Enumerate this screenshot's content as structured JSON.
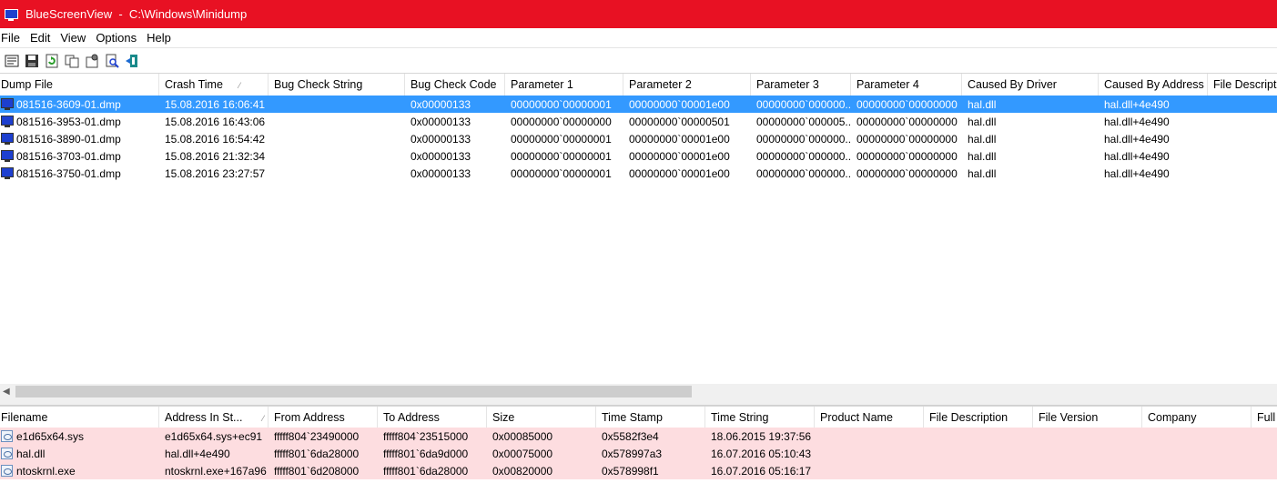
{
  "window": {
    "title": "BlueScreenView  -  C:\\Windows\\Minidump"
  },
  "menu": [
    "File",
    "Edit",
    "View",
    "Options",
    "Help"
  ],
  "toolbar": {
    "icons": [
      "properties-icon",
      "save-icon",
      "refresh-icon",
      "copy-icon",
      "settings-icon",
      "find-icon",
      "exit-icon"
    ]
  },
  "dumps": {
    "columns": [
      "Dump File",
      "Crash Time",
      "Bug Check String",
      "Bug Check Code",
      "Parameter 1",
      "Parameter 2",
      "Parameter 3",
      "Parameter 4",
      "Caused By Driver",
      "Caused By Address",
      "File Description"
    ],
    "sort_indicator": "⁄",
    "rows": [
      [
        "081516-3609-01.dmp",
        "15.08.2016 16:06:41",
        "",
        "0x00000133",
        "00000000`00000001",
        "00000000`00001e00",
        "00000000`000000...",
        "00000000`00000000",
        "hal.dll",
        "hal.dll+4e490",
        ""
      ],
      [
        "081516-3953-01.dmp",
        "15.08.2016 16:43:06",
        "",
        "0x00000133",
        "00000000`00000000",
        "00000000`00000501",
        "00000000`000005...",
        "00000000`00000000",
        "hal.dll",
        "hal.dll+4e490",
        ""
      ],
      [
        "081516-3890-01.dmp",
        "15.08.2016 16:54:42",
        "",
        "0x00000133",
        "00000000`00000001",
        "00000000`00001e00",
        "00000000`000000...",
        "00000000`00000000",
        "hal.dll",
        "hal.dll+4e490",
        ""
      ],
      [
        "081516-3703-01.dmp",
        "15.08.2016 21:32:34",
        "",
        "0x00000133",
        "00000000`00000001",
        "00000000`00001e00",
        "00000000`000000...",
        "00000000`00000000",
        "hal.dll",
        "hal.dll+4e490",
        ""
      ],
      [
        "081516-3750-01.dmp",
        "15.08.2016 23:27:57",
        "",
        "0x00000133",
        "00000000`00000001",
        "00000000`00001e00",
        "00000000`000000...",
        "00000000`00000000",
        "hal.dll",
        "hal.dll+4e490",
        ""
      ]
    ]
  },
  "drivers": {
    "columns": [
      "Filename",
      "Address In St...",
      "From Address",
      "To Address",
      "Size",
      "Time Stamp",
      "Time String",
      "Product Name",
      "File Description",
      "File Version",
      "Company",
      "Full"
    ],
    "sort_indicator": "⁄",
    "rows": [
      [
        "e1d65x64.sys",
        "e1d65x64.sys+ec91",
        "fffff804`23490000",
        "fffff804`23515000",
        "0x00085000",
        "0x5582f3e4",
        "18.06.2015 19:37:56",
        "",
        "",
        "",
        "",
        ""
      ],
      [
        "hal.dll",
        "hal.dll+4e490",
        "fffff801`6da28000",
        "fffff801`6da9d000",
        "0x00075000",
        "0x578997a3",
        "16.07.2016 05:10:43",
        "",
        "",
        "",
        "",
        ""
      ],
      [
        "ntoskrnl.exe",
        "ntoskrnl.exe+167a96",
        "fffff801`6d208000",
        "fffff801`6da28000",
        "0x00820000",
        "0x578998f1",
        "16.07.2016 05:16:17",
        "",
        "",
        "",
        "",
        ""
      ]
    ]
  },
  "colors": {
    "titlebar": "#e81123",
    "selection": "#3399ff",
    "highlight_row": "#fddde0"
  }
}
